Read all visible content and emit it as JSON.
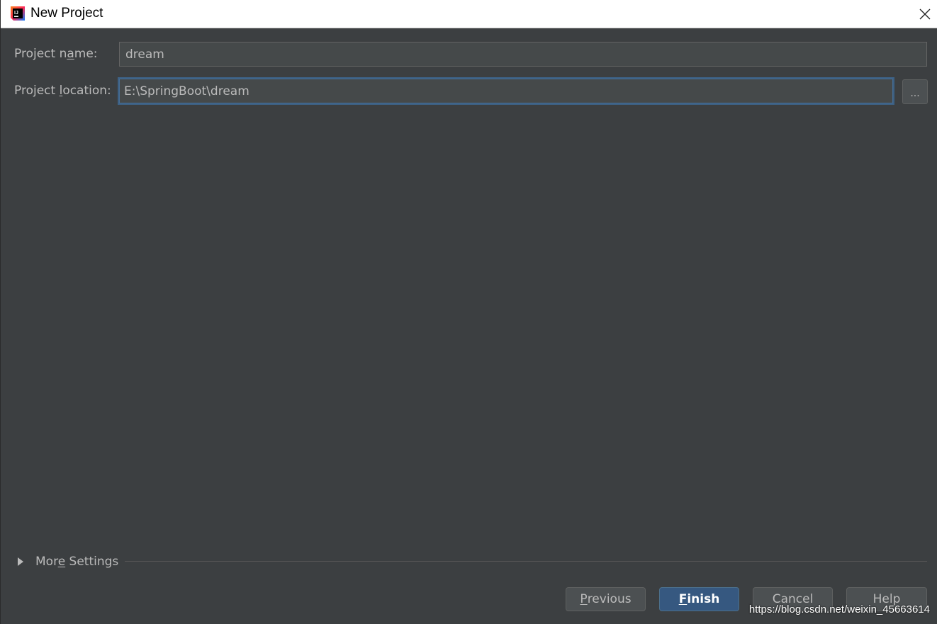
{
  "window": {
    "title": "New Project",
    "app_icon": "intellij-idea-icon",
    "close_icon": "close-icon"
  },
  "form": {
    "project_name": {
      "label_before": "Project n",
      "label_mnemonic": "a",
      "label_after": "me:",
      "value": "dream"
    },
    "project_location": {
      "label_before": "Project ",
      "label_mnemonic": "l",
      "label_after": "ocation:",
      "value": "E:\\SpringBoot\\dream",
      "browse_label": "..."
    }
  },
  "more_settings": {
    "label_before": "Mor",
    "label_mnemonic": "e",
    "label_after": " Settings",
    "expanded": false
  },
  "buttons": {
    "previous": {
      "mnemonic": "P",
      "rest": "revious"
    },
    "finish": {
      "mnemonic": "F",
      "rest": "inish"
    },
    "cancel": {
      "label": "Cancel"
    },
    "help": {
      "label": "Help"
    }
  },
  "watermark": "https://blog.csdn.net/weixin_45663614",
  "colors": {
    "background": "#3c3f41",
    "field_background": "#45494a",
    "text": "#bbbbbb",
    "focus_border": "#3d6185",
    "primary_button": "#365880"
  }
}
